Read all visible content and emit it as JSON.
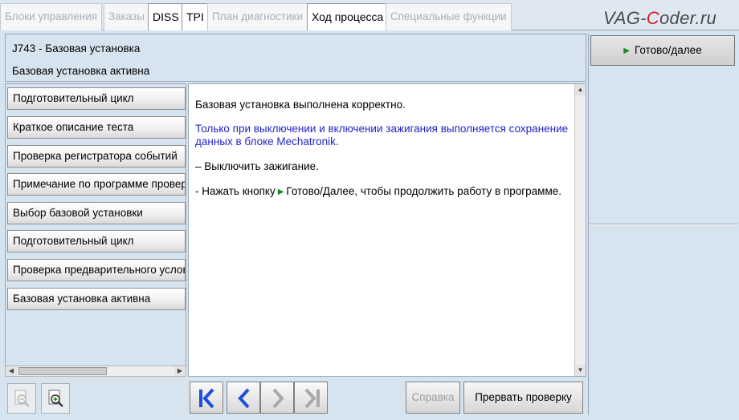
{
  "tabs": [
    {
      "label": "Блоки управления",
      "active": false
    },
    {
      "label": "Заказы",
      "active": false
    },
    {
      "label": "DISS",
      "active": true
    },
    {
      "label": "TPI",
      "active": true
    },
    {
      "label": "План диагностики",
      "active": false
    },
    {
      "label": "Ход процесса",
      "active": true
    },
    {
      "label": "Специальные функции",
      "active": false
    }
  ],
  "watermark": {
    "part1": "VAG-",
    "part2": "C",
    "part3": "oder.ru"
  },
  "header": {
    "line1": "J743 - Базовая установка",
    "line2": "Базовая установка активна"
  },
  "ready_button": {
    "label": "Готово/далее"
  },
  "steps": [
    "Подготовительный цикл",
    "Краткое описание теста",
    "Проверка регистратора событий",
    "Примечание по программе проверки",
    "Выбор базовой установки",
    "Подготовительный цикл",
    "Проверка предварительного условия",
    "Базовая установка активна"
  ],
  "content": {
    "p1": "Базовая установка выполнена корректно.",
    "p2": "Только при выключении и включении зажигания выполняется сохранение данных в блоке Mechatronik.",
    "p3": "– Выключить зажигание.",
    "p4a": "- Нажать кнопку",
    "p4b": "Готово/Далее, чтобы продолжить работу в программе."
  },
  "bottom": {
    "help_label": "Справка",
    "abort_label": "Прервать проверку"
  },
  "colors": {
    "background": "#d6e4f0",
    "info_text": "#2424c8",
    "play_green": "#1f8a1f",
    "nav_blue": "#1d4fd8"
  }
}
